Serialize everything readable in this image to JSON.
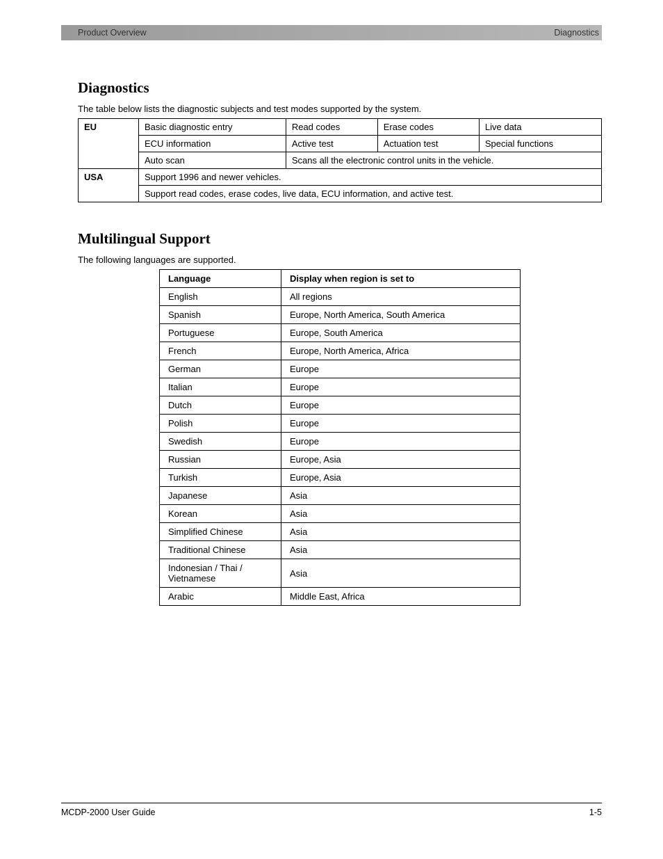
{
  "header": {
    "left": "Product Overview",
    "right": "Diagnostics"
  },
  "section1": {
    "title": "Diagnostics",
    "caption": "The table below lists the diagnostic subjects and test modes supported by the system.",
    "row_group_heads": {
      "eu": "EU",
      "usa": "USA"
    },
    "table": {
      "r1": {
        "a": "Basic diagnostic entry",
        "b": "Read codes",
        "c": "Erase codes",
        "d": "Live data"
      },
      "r2": {
        "a": "ECU information",
        "b": "Active test",
        "c": "Actuation test",
        "d": "Special functions"
      },
      "r3": {
        "a": "Auto scan",
        "b_span": "Scans all the electronic control units in the vehicle."
      },
      "r4": {
        "span": "Support 1996 and newer vehicles."
      },
      "r5": {
        "span": "Support read codes, erase codes, live data, ECU information, and active test."
      }
    }
  },
  "section2": {
    "title": "Multilingual Support",
    "caption": "The following languages are supported.",
    "headers": {
      "lang": "Language",
      "region": "Display when region is set to"
    },
    "rows": [
      {
        "lang": "English",
        "region": "All regions"
      },
      {
        "lang": "Spanish",
        "region": "Europe, North America, South America"
      },
      {
        "lang": "Portuguese",
        "region": "Europe, South America"
      },
      {
        "lang": "French",
        "region": "Europe, North America, Africa"
      },
      {
        "lang": "German",
        "region": "Europe"
      },
      {
        "lang": "Italian",
        "region": "Europe"
      },
      {
        "lang": "Dutch",
        "region": "Europe"
      },
      {
        "lang": "Polish",
        "region": "Europe"
      },
      {
        "lang": "Swedish",
        "region": "Europe"
      },
      {
        "lang": "Russian",
        "region": "Europe, Asia"
      },
      {
        "lang": "Turkish",
        "region": "Europe, Asia"
      },
      {
        "lang": "Japanese",
        "region": "Asia"
      },
      {
        "lang": "Korean",
        "region": "Asia"
      },
      {
        "lang": "Simplified Chinese",
        "region": "Asia"
      },
      {
        "lang": "Traditional Chinese",
        "region": "Asia"
      },
      {
        "lang": "Indonesian / Thai / Vietnamese",
        "region": "Asia"
      },
      {
        "lang": "Arabic",
        "region": "Middle East, Africa"
      }
    ]
  },
  "footer": {
    "left": "MCDP-2000 User Guide",
    "right": "1-5"
  }
}
